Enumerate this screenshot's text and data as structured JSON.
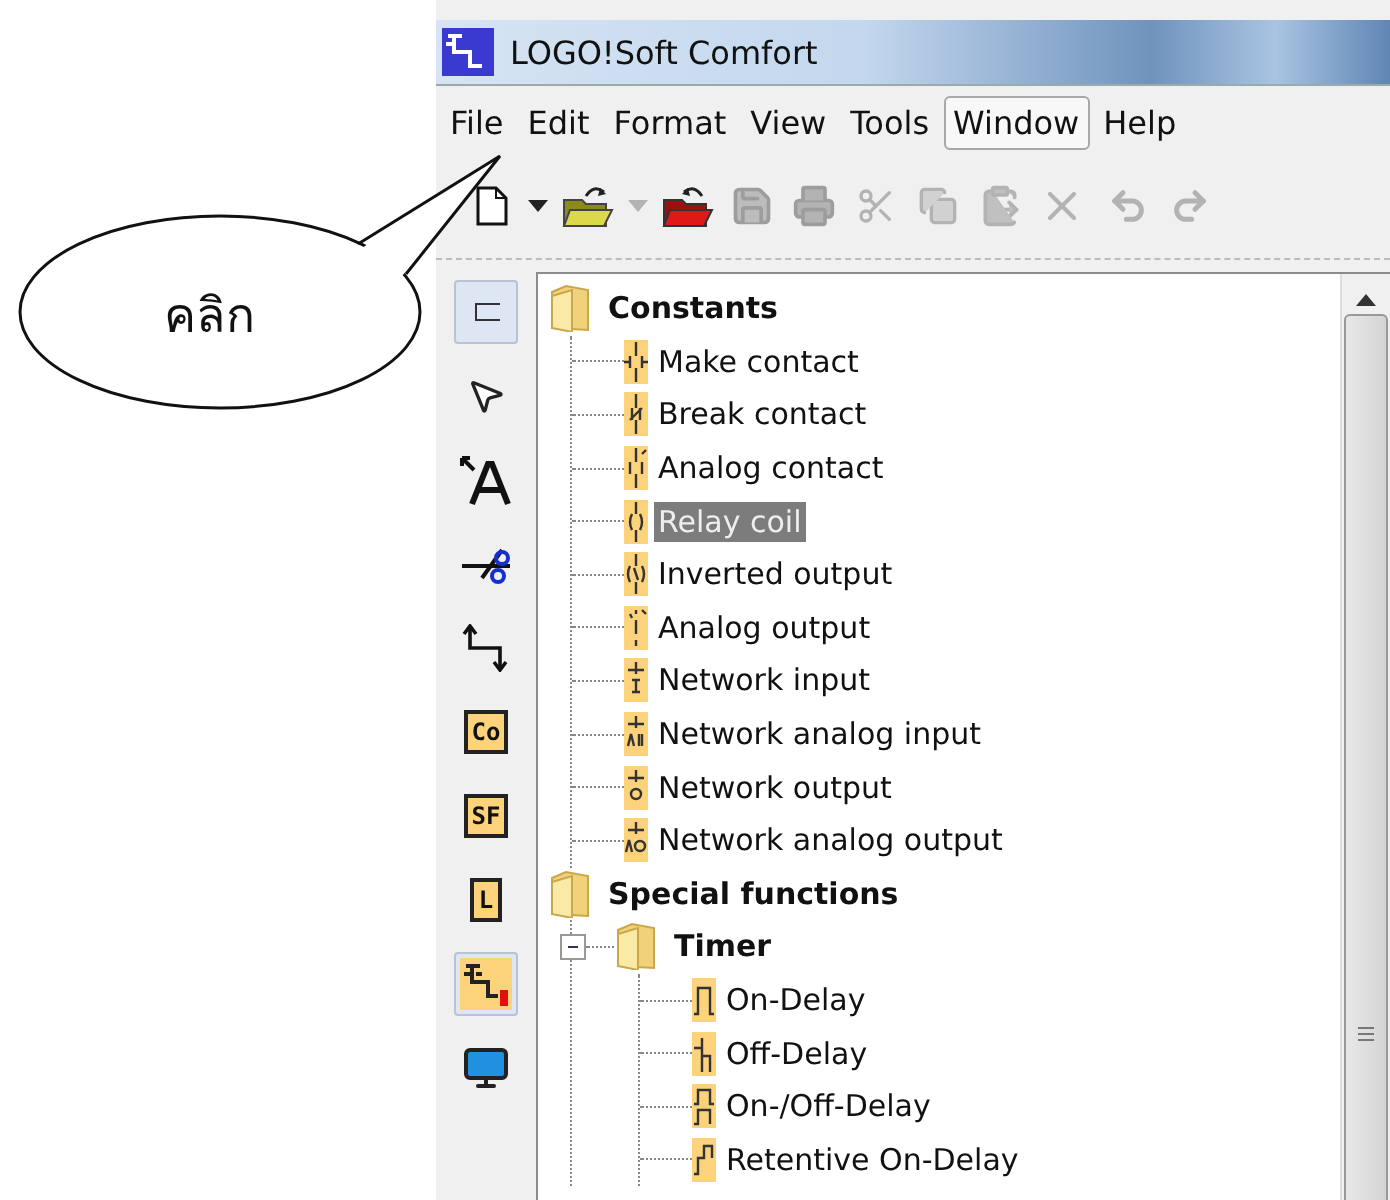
{
  "window": {
    "title": "LOGO!Soft Comfort"
  },
  "menu": [
    {
      "label": "File",
      "selected": false
    },
    {
      "label": "Edit",
      "selected": false
    },
    {
      "label": "Format",
      "selected": false
    },
    {
      "label": "View",
      "selected": false
    },
    {
      "label": "Tools",
      "selected": false
    },
    {
      "label": "Window",
      "selected": true
    },
    {
      "label": "Help",
      "selected": false
    }
  ],
  "toolbar": [
    {
      "kind": "new",
      "disabled": false
    },
    {
      "kind": "caret",
      "disabled": false
    },
    {
      "kind": "open",
      "disabled": false
    },
    {
      "kind": "caret",
      "disabled": true
    },
    {
      "kind": "close",
      "disabled": false
    },
    {
      "kind": "save",
      "disabled": true
    },
    {
      "kind": "print",
      "disabled": true
    },
    {
      "kind": "cut",
      "disabled": true
    },
    {
      "kind": "copy",
      "disabled": true
    },
    {
      "kind": "paste",
      "disabled": true
    },
    {
      "kind": "delete",
      "disabled": true
    },
    {
      "kind": "undo",
      "disabled": true
    },
    {
      "kind": "redo",
      "disabled": true
    }
  ],
  "tools": [
    {
      "kind": "frame",
      "selected": true
    },
    {
      "kind": "pointer",
      "selected": false
    },
    {
      "kind": "text",
      "selected": false
    },
    {
      "kind": "cut",
      "selected": false
    },
    {
      "kind": "connector",
      "selected": false
    },
    {
      "kind": "label",
      "label": "Co",
      "selected": false
    },
    {
      "kind": "label",
      "label": "SF",
      "selected": false
    },
    {
      "kind": "label",
      "label": "L",
      "selected": false
    },
    {
      "kind": "network",
      "selected": true
    },
    {
      "kind": "pc",
      "selected": false
    }
  ],
  "tree": [
    {
      "label": "Constants",
      "kind": "folder",
      "children": [
        {
          "label": "Make contact",
          "kind": "make",
          "selected": false
        },
        {
          "label": "Break contact",
          "kind": "break",
          "selected": false
        },
        {
          "label": "Analog contact",
          "kind": "analog",
          "selected": false
        },
        {
          "label": "Relay coil",
          "kind": "coil",
          "selected": true
        },
        {
          "label": "Inverted output",
          "kind": "inverted",
          "selected": false
        },
        {
          "label": "Analog output",
          "kind": "aout",
          "selected": false
        },
        {
          "label": "Network input",
          "kind": "ni",
          "selected": false
        },
        {
          "label": "Network analog input",
          "kind": "nai",
          "selected": false
        },
        {
          "label": "Network output",
          "kind": "no",
          "selected": false
        },
        {
          "label": "Network analog output",
          "kind": "nao",
          "selected": false
        }
      ]
    },
    {
      "label": "Special functions",
      "kind": "folder",
      "children": [
        {
          "label": "Timer",
          "kind": "folder",
          "expanded": true,
          "children": [
            {
              "label": "On-Delay",
              "kind": "ondelay",
              "selected": false
            },
            {
              "label": "Off-Delay",
              "kind": "offdelay",
              "selected": false
            },
            {
              "label": "On-/Off-Delay",
              "kind": "onoff",
              "selected": false
            },
            {
              "label": "Retentive On-Delay",
              "kind": "retentive",
              "selected": false
            }
          ]
        }
      ]
    }
  ],
  "callout": {
    "text": "คลิก"
  }
}
